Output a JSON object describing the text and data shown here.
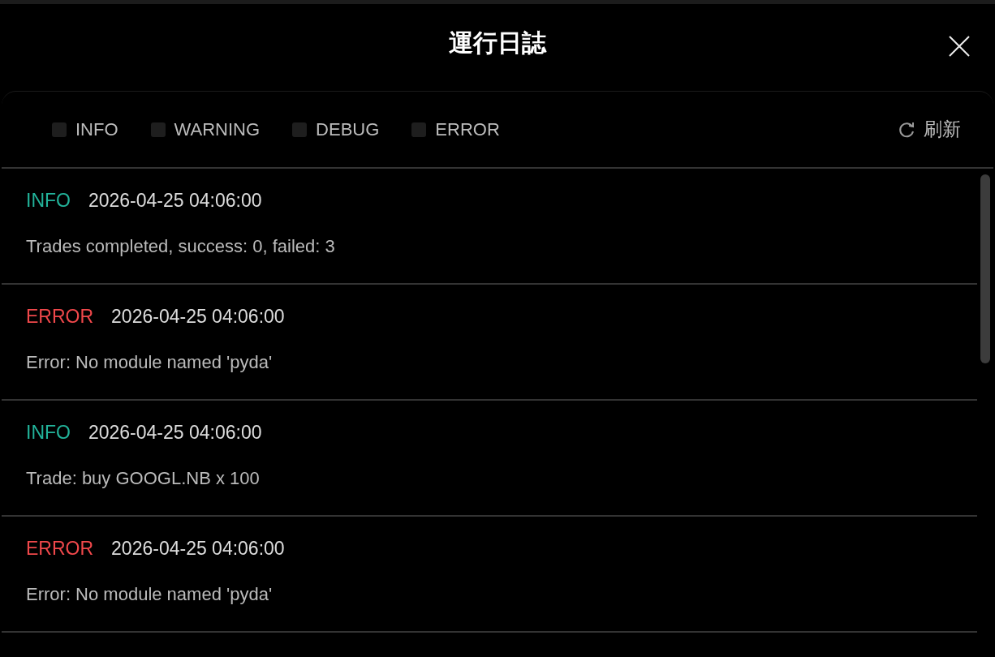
{
  "dialog": {
    "title": "運行日誌"
  },
  "filters": [
    {
      "label": "INFO",
      "checked": false
    },
    {
      "label": "WARNING",
      "checked": false
    },
    {
      "label": "DEBUG",
      "checked": false
    },
    {
      "label": "ERROR",
      "checked": false
    }
  ],
  "refresh_button": {
    "label": "刷新"
  },
  "logs": [
    {
      "kind": "info",
      "tag": "INFO",
      "time": "2026-04-25 04:06:00",
      "message": "Trades completed, success: 0, failed: 3"
    },
    {
      "kind": "error",
      "tag": "ERROR",
      "time": "2026-04-25 04:06:00",
      "message": "Error: No module named 'pyda'"
    },
    {
      "kind": "info",
      "tag": "INFO",
      "time": "2026-04-25 04:06:00",
      "message": "Trade: buy GOOGL.NB x 100"
    },
    {
      "kind": "error",
      "tag": "ERROR",
      "time": "2026-04-25 04:06:00",
      "message": "Error: No module named 'pyda'"
    }
  ]
}
